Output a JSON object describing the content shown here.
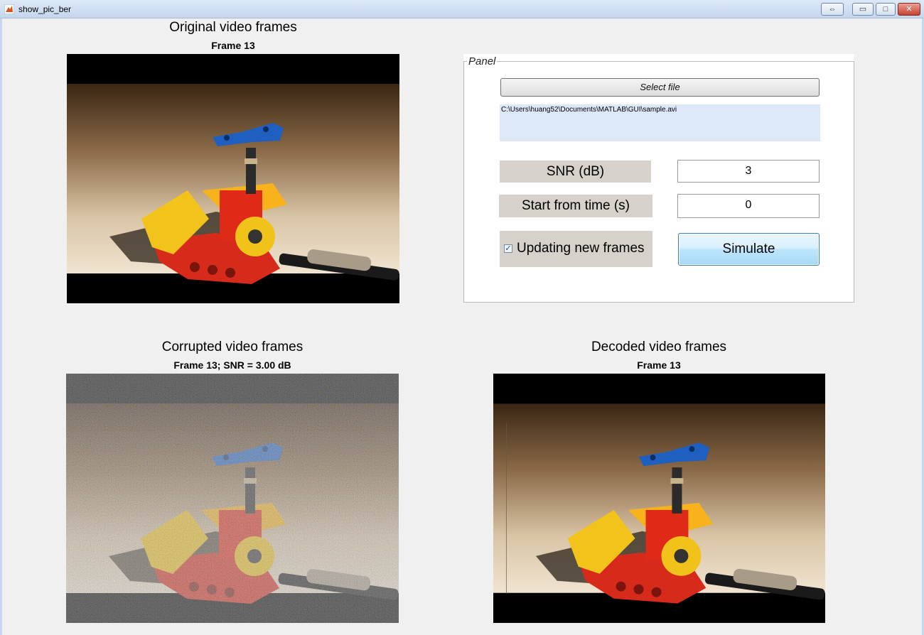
{
  "window": {
    "title": "show_pic_ber",
    "controls": [
      "restore-size",
      "minimize",
      "maximize",
      "close"
    ]
  },
  "axes": {
    "original": {
      "title": "Original video frames",
      "subtitle": "Frame 13"
    },
    "corrupted": {
      "title": "Corrupted video frames",
      "subtitle": "Frame 13; SNR = 3.00 dB"
    },
    "decoded": {
      "title": "Decoded video frames",
      "subtitle": "Frame 13"
    }
  },
  "panel": {
    "legend": "Panel",
    "select_file_label": "Select file",
    "file_path": "C:\\Users\\huang52\\Documents\\MATLAB\\GUI\\sample.avi",
    "snr_label": "SNR (dB)",
    "snr_value": "3",
    "start_time_label": "Start from time (s)",
    "start_time_value": "0",
    "update_frames_label": "Updating new frames",
    "update_frames_checked": true,
    "simulate_label": "Simulate"
  },
  "colors": {
    "panel_bg": "#ffffff",
    "label_bg": "#d6d2cb",
    "path_bg": "#dce8f8",
    "simulate_button": "#bee6fd"
  }
}
